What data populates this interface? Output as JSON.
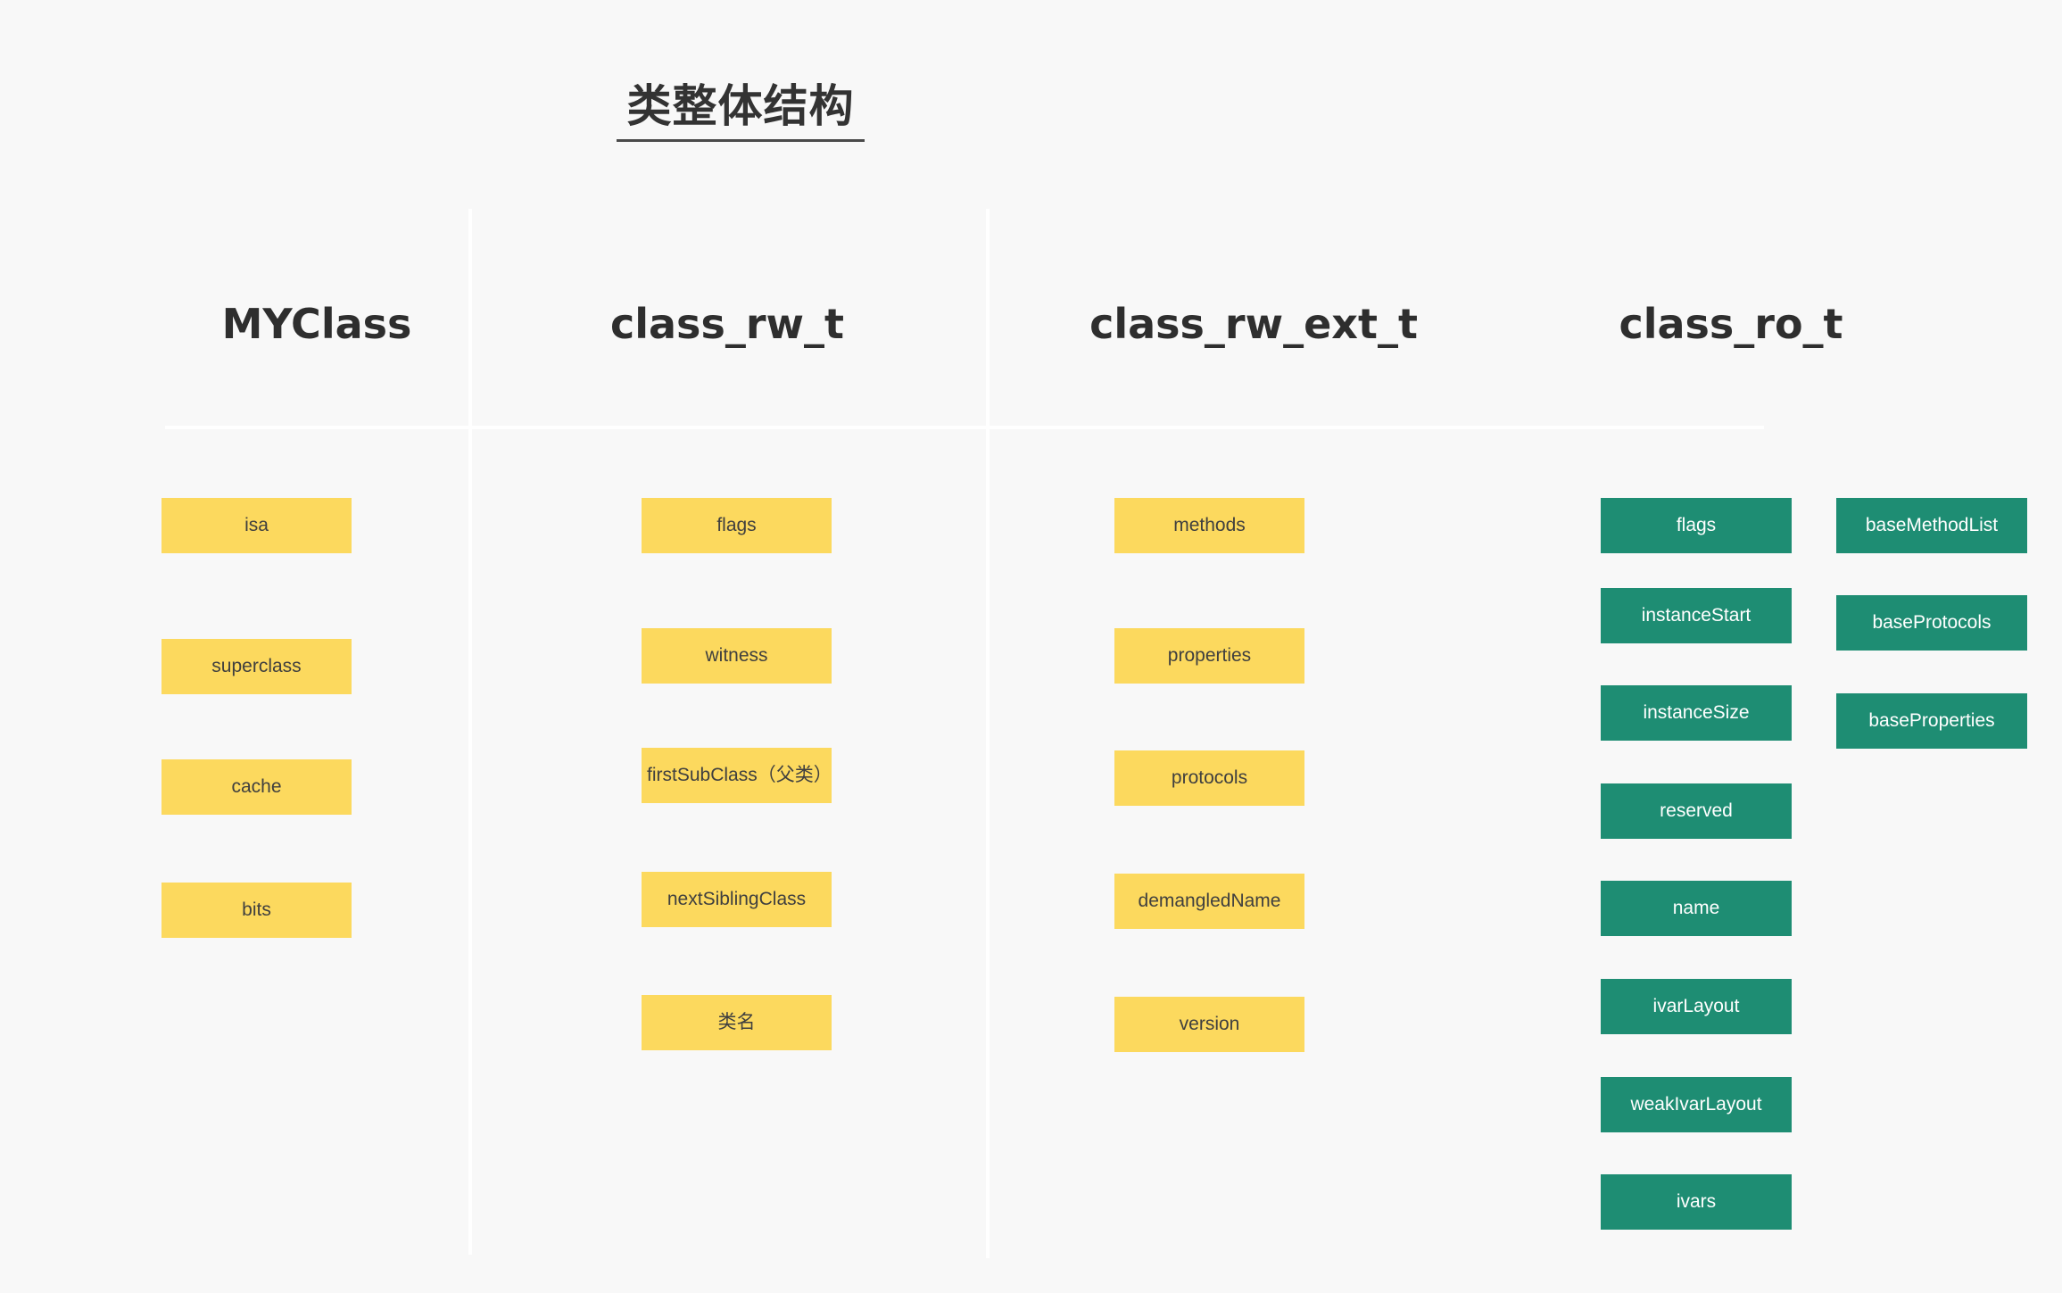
{
  "page": {
    "title": "类整体结构",
    "background_color": "#f8f8f8",
    "yellow_color": "#fcd95e",
    "green_color": "#1e8d73",
    "divider_color": "#ffffff"
  },
  "columns": [
    {
      "header": "MYClass",
      "style": "yellow",
      "fields": [
        {
          "label": "isa"
        },
        {
          "label": "superclass"
        },
        {
          "label": "cache"
        },
        {
          "label": "bits"
        }
      ]
    },
    {
      "header": "class_rw_t",
      "style": "yellow",
      "fields": [
        {
          "label": "flags"
        },
        {
          "label": "witness"
        },
        {
          "label": "firstSubClass（父类）"
        },
        {
          "label": "nextSiblingClass"
        },
        {
          "label": "类名"
        }
      ]
    },
    {
      "header": "class_rw_ext_t",
      "style": "yellow",
      "fields": [
        {
          "label": "methods"
        },
        {
          "label": "properties"
        },
        {
          "label": "protocols"
        },
        {
          "label": "demangledName"
        },
        {
          "label": "version"
        }
      ]
    },
    {
      "header": "class_ro_t",
      "style": "green",
      "fields": [
        {
          "label": "flags"
        },
        {
          "label": "instanceStart"
        },
        {
          "label": "instanceSize"
        },
        {
          "label": "reserved"
        },
        {
          "label": "name"
        },
        {
          "label": "ivarLayout"
        },
        {
          "label": "weakIvarLayout"
        },
        {
          "label": "ivars"
        }
      ],
      "fields_secondary": [
        {
          "label": "baseMethodList"
        },
        {
          "label": "baseProtocols"
        },
        {
          "label": "baseProperties"
        }
      ]
    }
  ]
}
